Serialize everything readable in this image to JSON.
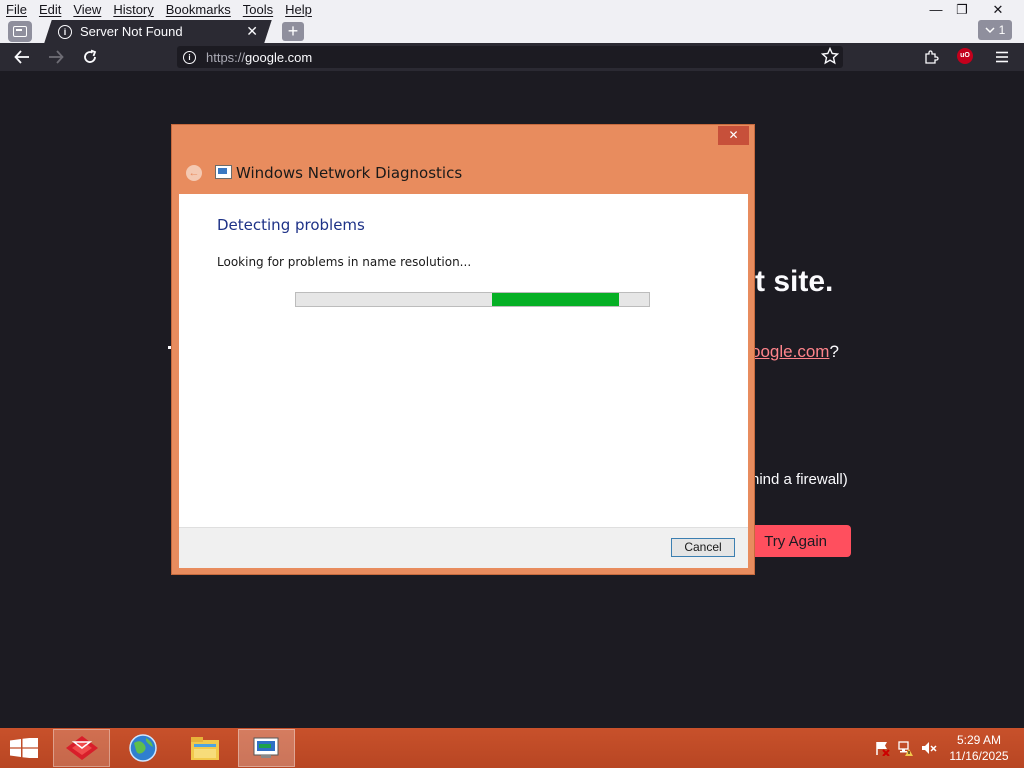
{
  "browser": {
    "menu": [
      "File",
      "Edit",
      "View",
      "History",
      "Bookmarks",
      "Tools",
      "Help"
    ],
    "window_controls": {
      "minimize": "—",
      "restore": "❐",
      "close": "✕"
    },
    "tab": {
      "title": "Server Not Found",
      "close": "✕"
    },
    "new_tab_glyph": "+",
    "tab_overflow_count": "1",
    "url": {
      "scheme": "https://",
      "host": "google.com"
    }
  },
  "error_page": {
    "title_fragment": "t site.",
    "link_text": "oogle.com",
    "link_suffix": "?",
    "firewall_fragment": "hind a firewall)",
    "try_again_label": "Try Again"
  },
  "dialog": {
    "close_glyph": "✕",
    "back_glyph": "←",
    "title": "Windows Network Diagnostics",
    "heading": "Detecting problems",
    "status": "Looking for problems in name resolution...",
    "progress": {
      "start_fraction": 0.555,
      "end_fraction": 0.915
    },
    "cancel_label": "Cancel",
    "accent_color": "#e88c5e"
  },
  "taskbar": {
    "items": [
      "app-red-diamond",
      "browser-globe",
      "file-explorer",
      "network-diagnostics"
    ],
    "active_item": "network-diagnostics",
    "tray": [
      "action-center-flag-icon",
      "network-icon",
      "volume-muted-icon"
    ],
    "time": "5:29 AM",
    "date": "11/16/2025",
    "color": "#c8512b"
  }
}
